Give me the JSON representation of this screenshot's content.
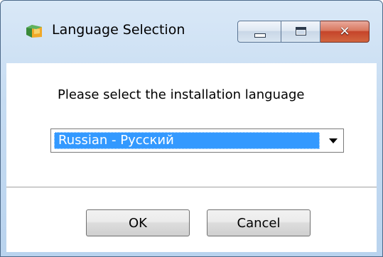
{
  "window": {
    "title": "Language Selection",
    "icon": "installer-icon",
    "caption_buttons": [
      "minimize-icon",
      "maximize-icon",
      "close-icon"
    ],
    "close_glyph": "✕"
  },
  "dialog": {
    "prompt": "Please select the installation language",
    "language_select": {
      "selected": "Russian - Русский"
    },
    "ok_label": "OK",
    "cancel_label": "Cancel"
  },
  "colors": {
    "selection": "#3399ff",
    "close_button": "#c5442a",
    "frame": "#b9d3ee"
  }
}
